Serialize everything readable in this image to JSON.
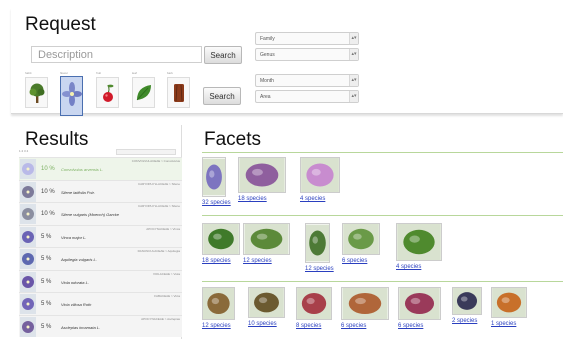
{
  "request": {
    "title": "Request",
    "description_placeholder": "Description",
    "search_label": "Search",
    "organs": [
      {
        "icon": "tree-icon",
        "label": "habit",
        "selected": false,
        "color": "#4a7a2a"
      },
      {
        "icon": "flower-icon",
        "label": "flower",
        "selected": true,
        "color": "#7a86c8"
      },
      {
        "icon": "fruit-icon",
        "label": "fruit",
        "selected": false,
        "color": "#d11a2a"
      },
      {
        "icon": "leaf-icon",
        "label": "leaf",
        "selected": false,
        "color": "#3f8a2a"
      },
      {
        "icon": "bark-icon",
        "label": "bark",
        "selected": false,
        "color": "#8b3a1a"
      }
    ],
    "selects": {
      "family": "Family",
      "genus": "Genus",
      "month": "Month",
      "area": "Area"
    }
  },
  "results": {
    "title": "Results",
    "toolbar_text": "1 2 3 4",
    "items": [
      {
        "pct": "10 %",
        "name": "Convolvulus arvensis L.",
        "family": "CONVOLVULACEAE > Convolvulus",
        "highlight": true,
        "color": "#b9b9e8"
      },
      {
        "pct": "10 %",
        "name": "Silene latifolia Poir.",
        "family": "CARYOPHYLLACEAE > Silene",
        "highlight": false,
        "color": "#7d7a9a"
      },
      {
        "pct": "10 %",
        "name": "Silene vulgaris (Moench) Garcke",
        "family": "CARYOPHYLLACEAE > Silene",
        "highlight": false,
        "color": "#8b8ea0"
      },
      {
        "pct": "5 %",
        "name": "Vinca major L.",
        "family": "APOCYNACEAE > Vinca",
        "highlight": false,
        "color": "#6a63b5"
      },
      {
        "pct": "5 %",
        "name": "Aquilegia vulgaris L.",
        "family": "RANUNCULACEAE > Aquilegia",
        "highlight": false,
        "color": "#5d68b0"
      },
      {
        "pct": "5 %",
        "name": "Viola odorata L.",
        "family": "VIOLACEAE > Viola",
        "highlight": false,
        "color": "#6a56a8"
      },
      {
        "pct": "5 %",
        "name": "Vicia villosa Roth",
        "family": "FABACEAE > Vicia",
        "highlight": false,
        "color": "#7265b8"
      },
      {
        "pct": "5 %",
        "name": "Asclepias incarnata L.",
        "family": "APOCYNACEAE > Asclepias",
        "highlight": false,
        "color": "#75609e"
      }
    ]
  },
  "facets": {
    "title": "Facets",
    "groups": [
      [
        {
          "count": "32 species",
          "color": "#7d74c0"
        },
        {
          "count": "18 species",
          "color": "#8f5f9e"
        },
        {
          "count": "4 species",
          "color": "#c88ccf"
        }
      ],
      [
        {
          "count": "18 species",
          "color": "#3f7a2a"
        },
        {
          "count": "12 species",
          "color": "#5c8a3a"
        },
        {
          "count": "12 species",
          "color": "#4d7a36"
        },
        {
          "count": "6 species",
          "color": "#6a9a48"
        },
        {
          "count": "4 species",
          "color": "#4f8a2e"
        }
      ],
      [
        {
          "count": "12 species",
          "color": "#8a6a3a"
        },
        {
          "count": "10 species",
          "color": "#6b5a30"
        },
        {
          "count": "8 species",
          "color": "#a8404a"
        },
        {
          "count": "6 species",
          "color": "#b0663a"
        },
        {
          "count": "6 species",
          "color": "#9a3a5a"
        },
        {
          "count": "2 species",
          "color": "#3a3a5a"
        },
        {
          "count": "1 species",
          "color": "#c8702a"
        }
      ]
    ]
  }
}
